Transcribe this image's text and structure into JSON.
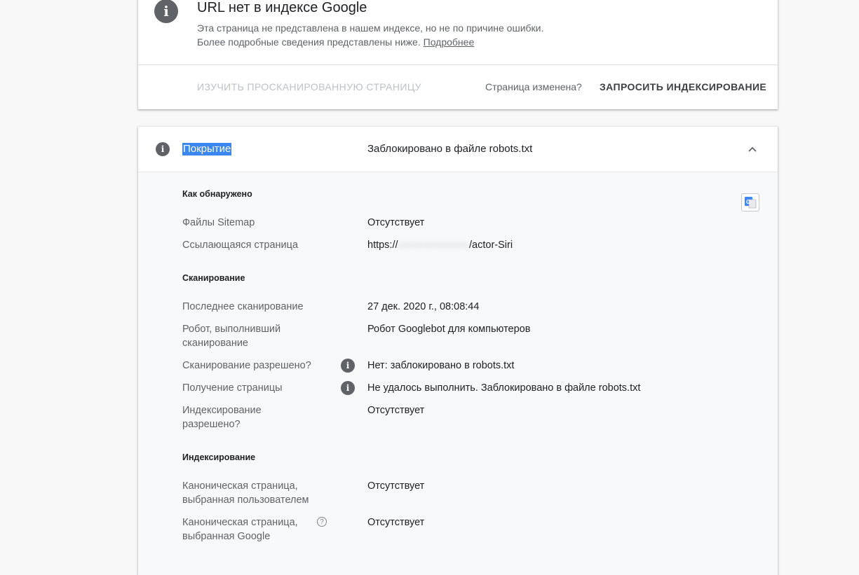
{
  "top_card": {
    "title": "URL нет в индексе Google",
    "desc_line1": "Эта страница не представлена в нашем индексе, но не по причине ошибки.",
    "desc_line2": "Более подробные сведения представлены ниже.",
    "more_link": "Подробнее",
    "inspect_button": "ИЗУЧИТЬ ПРОСКАНИРОВАННУЮ СТРАНИЦУ",
    "changed_text": "Страница изменена?",
    "request_button": "ЗАПРОСИТЬ ИНДЕКСИРОВАНИЕ"
  },
  "coverage": {
    "label": "Покрытие",
    "status": "Заблокировано в файле robots.txt",
    "sections": {
      "discovery": {
        "title": "Как обнаружено",
        "sitemaps_label": "Файлы Sitemap",
        "sitemaps_value": "Отсутствует",
        "referring_label": "Ссылающаяся страница",
        "referring_prefix": "https://",
        "referring_suffix": "/actor-Siri"
      },
      "crawl": {
        "title": "Сканирование",
        "last_crawl_label": "Последнее сканирование",
        "last_crawl_value": "27 дек. 2020 г., 08:08:44",
        "crawled_as_label_1": "Робот, выполнивший",
        "crawled_as_label_2": "сканирование",
        "crawled_as_value": "Робот Googlebot для компьютеров",
        "crawl_allowed_label": "Сканирование разрешено?",
        "crawl_allowed_value": "Нет: заблокировано в robots.txt",
        "page_fetch_label": "Получение страницы",
        "page_fetch_value": "Не удалось выполнить. Заблокировано в файле robots.txt",
        "index_allowed_label_1": "Индексирование",
        "index_allowed_label_2": "разрешено?",
        "index_allowed_value": "Отсутствует"
      },
      "indexing": {
        "title": "Индексирование",
        "user_canonical_label_1": "Каноническая страница,",
        "user_canonical_label_2": "выбранная пользователем",
        "user_canonical_value": "Отсутствует",
        "google_canonical_label_1": "Каноническая страница,",
        "google_canonical_label_2": "выбранная Google",
        "google_canonical_value": "Отсутствует"
      }
    }
  },
  "colors": {
    "selection": "#3b86f0",
    "icon_gray": "#5f6368",
    "background": "#f8f8f8"
  },
  "icons": {
    "status": "info-icon",
    "collapse": "chevron-up-icon",
    "translate": "google-translate-icon",
    "help": "help-circle-icon"
  }
}
